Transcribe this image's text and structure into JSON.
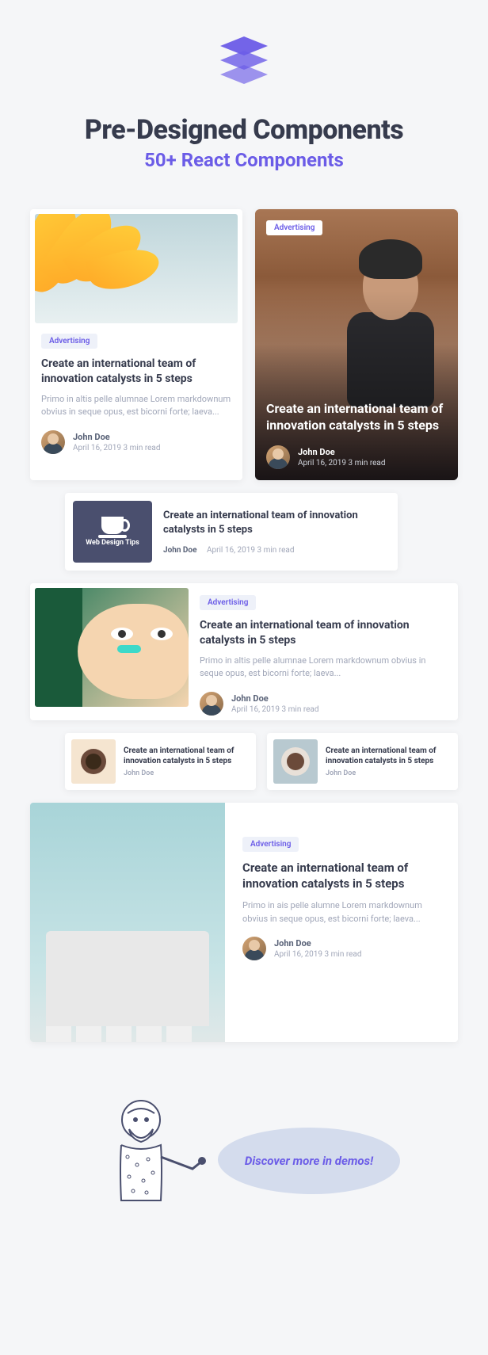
{
  "header": {
    "title": "Pre-Designed Components",
    "subtitle": "50+ React Components"
  },
  "cards": {
    "c1": {
      "tag": "Advertising",
      "title": "Create an international team of innovation catalysts in 5 steps",
      "excerpt": "Primo in altis pelle alumnae Lorem markdownum obvius in seque opus, est bicorni forte; laeva...",
      "author": "John Doe",
      "date": "April 16, 2019 3 min read"
    },
    "c2": {
      "tag": "Advertising",
      "title": "Create an international team of innovation catalysts in 5 steps",
      "author": "John Doe",
      "date": "April 16, 2019 3 min read"
    },
    "c3": {
      "thumb_label": "Web Design Tips",
      "title": "Create an international team of innovation catalysts in 5 steps",
      "author": "John Doe",
      "date": "April 16, 2019 3 min read"
    },
    "c4": {
      "tag": "Advertising",
      "title": "Create an international team of innovation catalysts in 5 steps",
      "excerpt": "Primo in altis pelle alumnae Lorem markdownum obvius in seque opus, est bicorni forte; laeva...",
      "author": "John Doe",
      "date": "April 16, 2019 3 min read"
    },
    "c5": {
      "title": "Create an international team of innovation catalysts in 5 steps",
      "author": "John Doe"
    },
    "c6": {
      "title": "Create an international team of innovation catalysts in 5 steps",
      "author": "John Doe"
    },
    "c7": {
      "tag": "Advertising",
      "title": "Create an international team of innovation catalysts in 5 steps",
      "excerpt": "Primo in ais pelle alumne Lorem markdownum obvius in seque opus, est bicorni forte; laeva...",
      "author": "John Doe",
      "date": "April 16, 2019 3 min read"
    }
  },
  "footer": {
    "cta": "Discover more in demos!"
  }
}
